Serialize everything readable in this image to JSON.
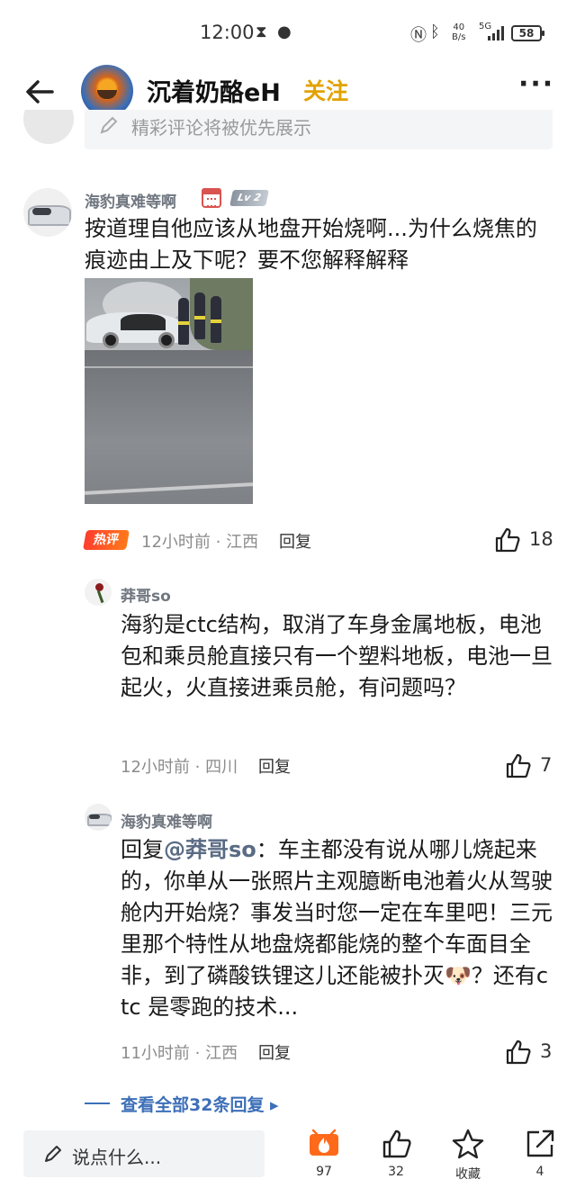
{
  "status_bar": {
    "time": "12:00",
    "speed_top": "40",
    "speed_bottom": "B/s",
    "network": "5G",
    "battery": "58"
  },
  "header": {
    "name": "沉着奶酪eH",
    "follow_label": "关注",
    "more_label": "···"
  },
  "notice": {
    "text": "精彩评论将被优先展示"
  },
  "comment": {
    "username": "海豹真难等啊",
    "level": "Lv 2",
    "text": "按道理自他应该从地盘开始烧啊...为什么烧焦的痕迹由上及下呢？要不您解释解释",
    "hot_badge": "热评",
    "meta": "12小时前 · 江西",
    "reply_label": "回复",
    "likes": "18"
  },
  "replies": [
    {
      "username": "莽哥so",
      "text": "海豹是ctc结构，取消了车身金属地板，电池包和乘员舱直接只有一个塑料地板，电池一旦起火，火直接进乘员舱，有问题吗？",
      "meta": "12小时前 · 四川",
      "reply_label": "回复",
      "likes": "7"
    },
    {
      "username": "海豹真难等啊",
      "reply_prefix": "回复",
      "mention": "@莽哥so",
      "text": "：车主都没有说从哪儿烧起来的，你单从一张照片主观臆断电池着火从驾驶舱内开始烧？事发当时您一定在车里吧！三元里那个特性从地盘烧都能烧的整个车面目全非，到了磷酸铁锂这儿还能被扑灭🐶？还有ctc 是零跑的技术...",
      "meta": "11小时前 · 江西",
      "reply_label": "回复",
      "likes": "3"
    }
  ],
  "expand_label": "查看全部32条回复 ▸",
  "bottom_bar": {
    "input_placeholder": "说点什么...",
    "hot_count": "97",
    "like_count": "32",
    "favorite_label": "收藏",
    "share_count": "4"
  },
  "colors": {
    "accent_follow": "#e2a200",
    "link_blue": "#3d6fb8",
    "hot_red": "#ff3d2e"
  },
  "icons": [
    "back-arrow-icon",
    "more-icon",
    "thumbs-up-icon",
    "pencil-icon",
    "fire-icon",
    "star-icon",
    "share-icon",
    "calendar-icon"
  ]
}
